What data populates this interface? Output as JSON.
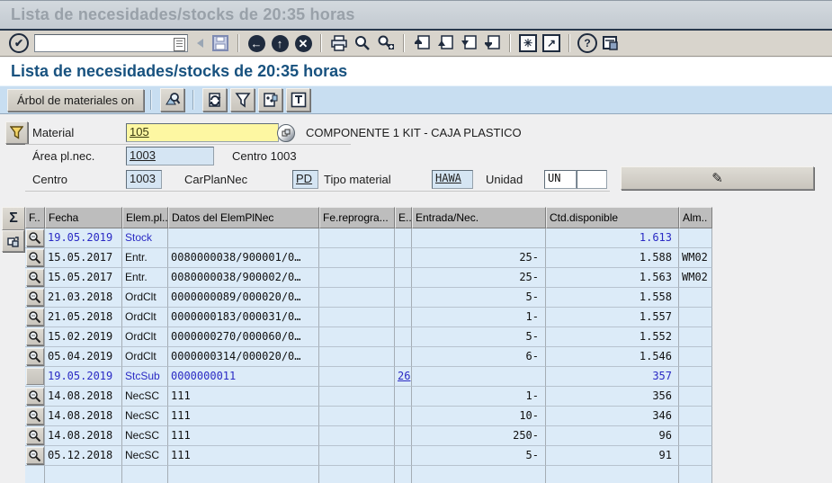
{
  "window": {
    "title": "Lista de necesidades/stocks de 20:35 horas"
  },
  "standard_toolbar": {
    "command_value": "",
    "icons": [
      "enter",
      "command-list",
      "collapse",
      "save",
      "back",
      "exit",
      "cancel",
      "print",
      "find",
      "find-next",
      "first-page",
      "previous-page",
      "next-page",
      "last-page",
      "new-session",
      "shortcut",
      "help",
      "customize-layout"
    ]
  },
  "app": {
    "title": "Lista de necesidades/stocks de 20:35 horas",
    "toolbar": {
      "tree_button": "Árbol de materiales on",
      "icons": [
        "overview",
        "refresh",
        "filter",
        "order-report",
        "export"
      ]
    }
  },
  "header": {
    "material": {
      "label": "Material",
      "value": "105",
      "description": "COMPONENTE 1 KIT - CAJA PLASTICO"
    },
    "area": {
      "label": "Área pl.nec.",
      "value": "1003",
      "note": "Centro 1003"
    },
    "centro": {
      "label": "Centro",
      "value": "1003"
    },
    "carplannec": {
      "label": "CarPlanNec",
      "value": "PD"
    },
    "tipo_material": {
      "label": "Tipo material",
      "value": "HAWA"
    },
    "unidad": {
      "label": "Unidad",
      "value": "UN",
      "value2": ""
    }
  },
  "table": {
    "columns": [
      "F..",
      "Fecha",
      "Elem.pl..",
      "Datos del ElemPlNec",
      "Fe.reprogra...",
      "E..",
      "Entrada/Nec.",
      "Ctd.disponible",
      "Alm.."
    ],
    "rows": [
      {
        "icon": "magnifier",
        "fecha": "19.05.2019",
        "elem": "Stock",
        "datos": "",
        "fe": "",
        "e": "",
        "entrada": "",
        "ctd": "1.613",
        "alm": "",
        "blue": true,
        "e_link": false
      },
      {
        "icon": "magnifier",
        "fecha": "15.05.2017",
        "elem": "Entr.",
        "datos": "0080000038/900001/0…",
        "fe": "",
        "e": "",
        "entrada": "25-",
        "ctd": "1.588",
        "alm": "WM02",
        "blue": false,
        "e_link": false
      },
      {
        "icon": "magnifier",
        "fecha": "15.05.2017",
        "elem": "Entr.",
        "datos": "0080000038/900002/0…",
        "fe": "",
        "e": "",
        "entrada": "25-",
        "ctd": "1.563",
        "alm": "WM02",
        "blue": false,
        "e_link": false
      },
      {
        "icon": "magnifier",
        "fecha": "21.03.2018",
        "elem": "OrdClt",
        "datos": "0000000089/000020/0…",
        "fe": "",
        "e": "",
        "entrada": "5-",
        "ctd": "1.558",
        "alm": "",
        "blue": false,
        "e_link": false
      },
      {
        "icon": "magnifier",
        "fecha": "21.05.2018",
        "elem": "OrdClt",
        "datos": "0000000183/000031/0…",
        "fe": "",
        "e": "",
        "entrada": "1-",
        "ctd": "1.557",
        "alm": "",
        "blue": false,
        "e_link": false
      },
      {
        "icon": "magnifier",
        "fecha": "15.02.2019",
        "elem": "OrdClt",
        "datos": "0000000270/000060/0…",
        "fe": "",
        "e": "",
        "entrada": "5-",
        "ctd": "1.552",
        "alm": "",
        "blue": false,
        "e_link": false
      },
      {
        "icon": "magnifier",
        "fecha": "05.04.2019",
        "elem": "OrdClt",
        "datos": "0000000314/000020/0…",
        "fe": "",
        "e": "",
        "entrada": "6-",
        "ctd": "1.546",
        "alm": "",
        "blue": false,
        "e_link": false
      },
      {
        "icon": "blank",
        "fecha": "19.05.2019",
        "elem": "StcSub",
        "datos": "0000000011",
        "fe": "",
        "e": "26",
        "entrada": "",
        "ctd": "357",
        "alm": "",
        "blue": true,
        "e_link": true
      },
      {
        "icon": "magnifier",
        "fecha": "14.08.2018",
        "elem": "NecSC",
        "datos": "111",
        "fe": "",
        "e": "",
        "entrada": "1-",
        "ctd": "356",
        "alm": "",
        "blue": false,
        "e_link": false
      },
      {
        "icon": "magnifier",
        "fecha": "14.08.2018",
        "elem": "NecSC",
        "datos": "111",
        "fe": "",
        "e": "",
        "entrada": "10-",
        "ctd": "346",
        "alm": "",
        "blue": false,
        "e_link": false
      },
      {
        "icon": "magnifier",
        "fecha": "14.08.2018",
        "elem": "NecSC",
        "datos": "111",
        "fe": "",
        "e": "",
        "entrada": "250-",
        "ctd": "96",
        "alm": "",
        "blue": false,
        "e_link": false
      },
      {
        "icon": "magnifier",
        "fecha": "05.12.2018",
        "elem": "NecSC",
        "datos": "111",
        "fe": "",
        "e": "",
        "entrada": "5-",
        "ctd": "91",
        "alm": "",
        "blue": false,
        "e_link": false
      }
    ]
  },
  "colors": {
    "app_title_blue": "#18527f",
    "link_blue": "#2a2ac4",
    "field_yellow": "#fdf7a2",
    "field_blue": "#d5e5f3",
    "row_blue": "#dcebf8",
    "apptoolbar_blue": "#c8def1",
    "toolbar_gray": "#d8d4cc",
    "header_gray": "#bdbdbd"
  }
}
